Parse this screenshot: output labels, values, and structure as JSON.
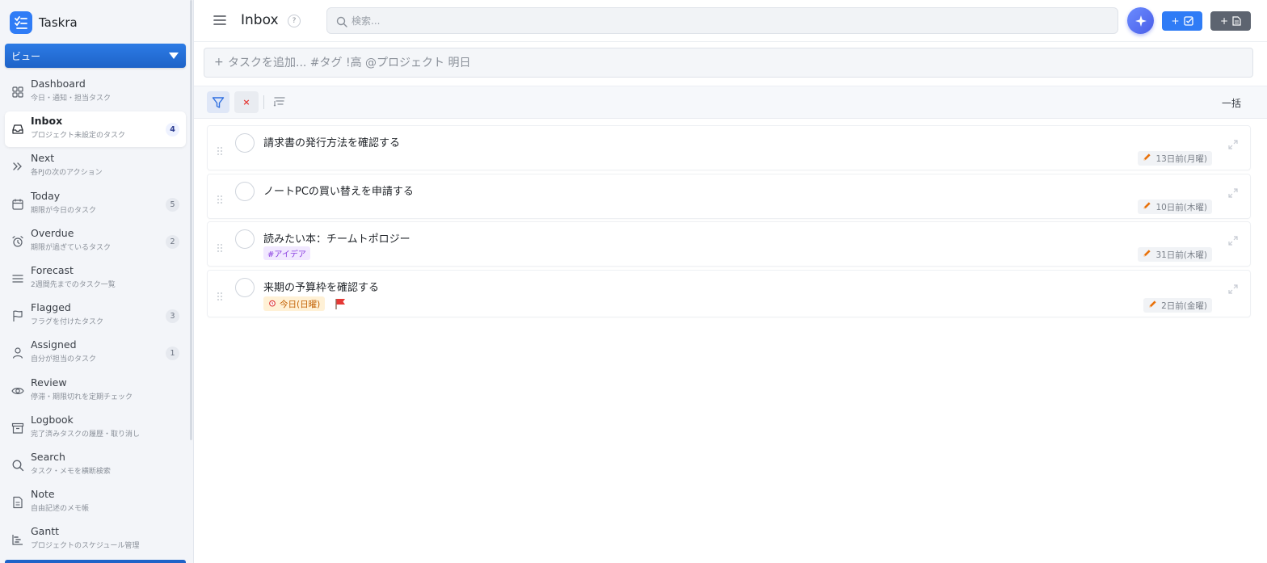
{
  "app": {
    "name": "Taskra",
    "view_select": "ビュー"
  },
  "sidebar": {
    "items": [
      {
        "key": "dashboard",
        "label": "Dashboard",
        "sub": "今日・通知・担当タスク",
        "badge": null,
        "icon": "grid-icon",
        "active": false
      },
      {
        "key": "inbox",
        "label": "Inbox",
        "sub": "プロジェクト未設定のタスク",
        "badge": "4",
        "icon": "inbox-icon",
        "active": true
      },
      {
        "key": "next",
        "label": "Next",
        "sub": "各PJの次のアクション",
        "badge": null,
        "icon": "double-chevron-icon",
        "active": false
      },
      {
        "key": "today",
        "label": "Today",
        "sub": "期限が今日のタスク",
        "badge": "5",
        "icon": "calendar-icon",
        "active": false
      },
      {
        "key": "overdue",
        "label": "Overdue",
        "sub": "期限が過ぎているタスク",
        "badge": "2",
        "icon": "alarm-icon",
        "active": false
      },
      {
        "key": "forecast",
        "label": "Forecast",
        "sub": "2週間先までのタスク一覧",
        "badge": null,
        "icon": "list-icon",
        "active": false
      },
      {
        "key": "flagged",
        "label": "Flagged",
        "sub": "フラグを付けたタスク",
        "badge": "3",
        "icon": "flag-icon",
        "active": false
      },
      {
        "key": "assigned",
        "label": "Assigned",
        "sub": "自分が担当のタスク",
        "badge": "1",
        "icon": "person-icon",
        "active": false
      },
      {
        "key": "review",
        "label": "Review",
        "sub": "停滞・期限切れを定期チェック",
        "badge": null,
        "icon": "eye-icon",
        "active": false
      },
      {
        "key": "logbook",
        "label": "Logbook",
        "sub": "完了済みタスクの履歴・取り消し",
        "badge": null,
        "icon": "archive-icon",
        "active": false
      },
      {
        "key": "search",
        "label": "Search",
        "sub": "タスク・メモを横断検索",
        "badge": null,
        "icon": "search-icon",
        "active": false
      },
      {
        "key": "note",
        "label": "Note",
        "sub": "自由記述のメモ帳",
        "badge": null,
        "icon": "document-icon",
        "active": false
      },
      {
        "key": "gantt",
        "label": "Gantt",
        "sub": "プロジェクトのスケジュール管理",
        "badge": null,
        "icon": "gantt-icon",
        "active": false
      }
    ]
  },
  "header": {
    "title": "Inbox",
    "help": "?",
    "search_placeholder": "検索...",
    "ai_icon": "sparkle-icon",
    "add_task_label": "+",
    "add_note_label": "+"
  },
  "quickadd": {
    "plus": "+",
    "placeholder": "タスクを追加... #タグ !高 @プロジェクト 明日"
  },
  "filterbar": {
    "clear_label": "×",
    "bulk_label": "一括"
  },
  "tasks": [
    {
      "title": "請求書の発行方法を確認する",
      "tag": null,
      "due_today": null,
      "flagged": false,
      "date": "13日前(月曜)"
    },
    {
      "title": "ノートPCの買い替えを申請する",
      "tag": null,
      "due_today": null,
      "flagged": false,
      "date": "10日前(木曜)"
    },
    {
      "title": "読みたい本：チームトポロジー",
      "tag": "#アイデア",
      "due_today": null,
      "flagged": false,
      "date": "31日前(木曜)"
    },
    {
      "title": "来期の予算枠を確認する",
      "tag": null,
      "due_today": "今日(日曜)",
      "flagged": true,
      "date": "2日前(金曜)"
    }
  ],
  "colors": {
    "accent": "#2f7cf6",
    "view_select": "#1e63c8",
    "flag": "#e53935",
    "tag_text": "#8a3fe0",
    "due_today_bg": "#fff1d6",
    "edit_pencil": "#e8710a"
  }
}
